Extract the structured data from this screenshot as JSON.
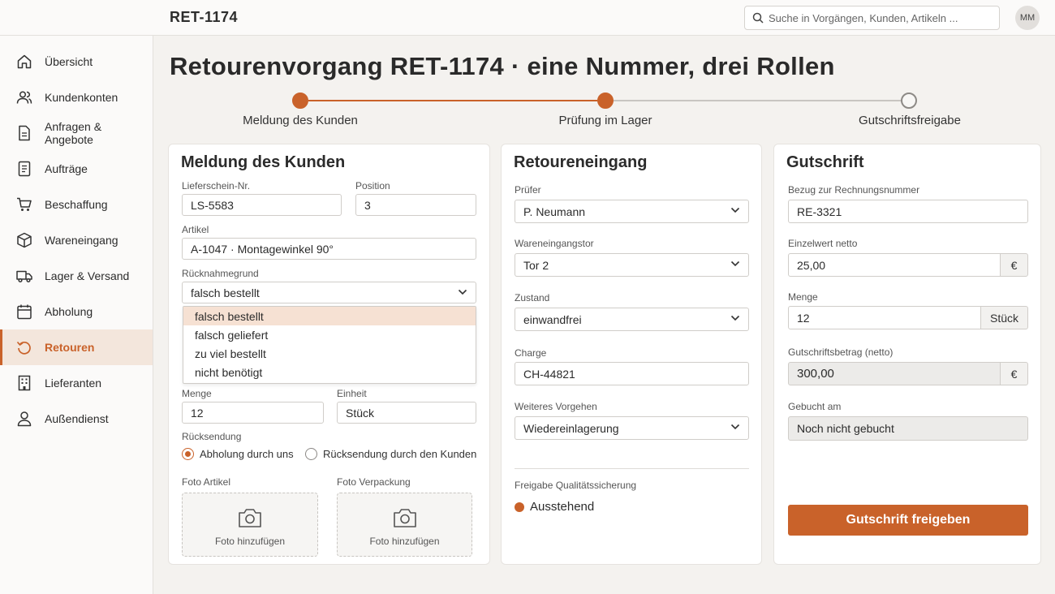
{
  "header": {
    "ticket_id": "RET-1174",
    "search_placeholder": "Suche in Vorgängen, Kunden, Artikeln ...",
    "avatar_initials": "MM"
  },
  "sidebar": {
    "items": [
      {
        "label": "Übersicht",
        "icon": "home-icon"
      },
      {
        "label": "Kundenkonten",
        "icon": "users-icon"
      },
      {
        "label": "Anfragen & Angebote",
        "icon": "document-icon"
      },
      {
        "label": "Aufträge",
        "icon": "list-document-icon"
      },
      {
        "label": "Beschaffung",
        "icon": "cart-icon"
      },
      {
        "label": "Wareneingang",
        "icon": "box-icon"
      },
      {
        "label": "Lager & Versand",
        "icon": "truck-icon"
      },
      {
        "label": "Abholung",
        "icon": "calendar-icon"
      },
      {
        "label": "Retouren",
        "icon": "return-icon",
        "active": true
      },
      {
        "label": "Lieferanten",
        "icon": "building-icon"
      },
      {
        "label": "Außendienst",
        "icon": "person-icon"
      }
    ]
  },
  "page": {
    "title": "Retourenvorgang RET-1174 · eine Nummer, drei Rollen"
  },
  "steps": [
    {
      "label": "Meldung des Kunden",
      "state": "done"
    },
    {
      "label": "Prüfung im Lager",
      "state": "done"
    },
    {
      "label": "Gutschriftsfreigabe",
      "state": "todo"
    }
  ],
  "customer_card": {
    "title": "Meldung des Kunden",
    "delivery_note_label": "Lieferschein-Nr.",
    "delivery_note_value": "LS-5583",
    "position_label": "Position",
    "position_value": "3",
    "article_label": "Artikel",
    "article_value": "A-1047 · Montagewinkel 90°",
    "reason_label": "Rücknahmegrund",
    "reason_value": "falsch bestellt",
    "reason_options": [
      "falsch bestellt",
      "falsch geliefert",
      "zu viel bestellt",
      "nicht benötigt"
    ],
    "quantity_label": "Menge",
    "quantity_value": "12",
    "unit_label": "Einheit",
    "unit_value": "Stück",
    "return_label": "Rücksendung",
    "return_option_1": "Abholung durch uns",
    "return_option_2": "Rücksendung durch den Kunden",
    "photo_article_label": "Foto Artikel",
    "photo_packaging_label": "Foto Verpackung",
    "photo_add_label": "Foto hinzufügen"
  },
  "warehouse_card": {
    "title": "Retoureneingang",
    "inspector_label": "Prüfer",
    "inspector_value": "P. Neumann",
    "gate_label": "Wareneingangstor",
    "gate_value": "Tor 2",
    "condition_label": "Zustand",
    "condition_value": "einwandfrei",
    "batch_label": "Charge",
    "batch_value": "CH-44821",
    "next_label": "Weiteres Vorgehen",
    "next_value": "Wiedereinlagerung",
    "qa_label": "Freigabe Qualitätssicherung",
    "qa_status": "Ausstehend"
  },
  "credit_card": {
    "title": "Gutschrift",
    "invoice_ref_label": "Bezug zur Rechnungsnummer",
    "invoice_ref_value": "RE-3321",
    "unit_value_label": "Einzelwert netto",
    "unit_value_value": "25,00",
    "currency": "€",
    "quantity_label": "Menge",
    "quantity_value": "12",
    "quantity_unit": "Stück",
    "credit_amount_label": "Gutschriftsbetrag (netto)",
    "credit_amount_value": "300,00",
    "booked_label": "Gebucht am",
    "booked_value": "Noch nicht gebucht",
    "approve_button": "Gutschrift freigeben"
  },
  "colors": {
    "accent": "#c9622a",
    "background": "#f4f2ef",
    "card": "#ffffff"
  }
}
